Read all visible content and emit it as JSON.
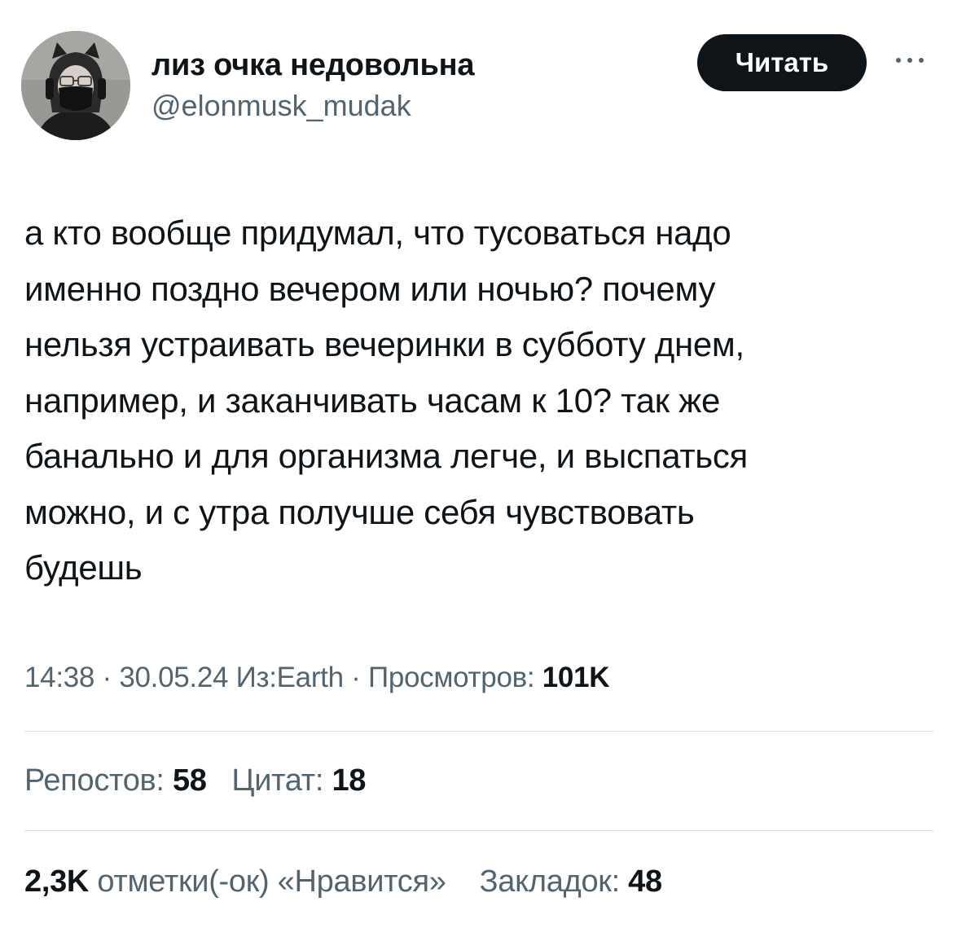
{
  "user": {
    "display_name": "лиз очка недовольна",
    "handle": "@elonmusk_mudak",
    "avatar_icon": "avatar-photo"
  },
  "actions": {
    "follow_label": "Читать",
    "more_icon": "more-icon"
  },
  "tweet": {
    "lines": [
      "а кто вообще придумал, что тусоваться надо",
      "именно поздно вечером или ночью? почему",
      "нельзя устраивать вечеринки в субботу днем,",
      "например, и заканчивать часам к 10? так же",
      "банально и для организма легче, и выспаться",
      "можно, и с утра получше себя чувствовать",
      "будешь"
    ]
  },
  "meta": {
    "time": "14:38",
    "sep1": " · ",
    "date": "30.05.24",
    "source": "Из:Earth",
    "sep2": " · ",
    "views_label": "Просмотров: ",
    "views_value": "101K"
  },
  "stats": {
    "reposts_label": "Репостов: ",
    "reposts_value": "58",
    "quotes_label": "Цитат: ",
    "quotes_value": "18",
    "likes_value": "2,3K",
    "likes_label": " отметки(-ок) «Нравится»",
    "bookmarks_label": "Закладок: ",
    "bookmarks_value": "48"
  },
  "colors": {
    "text": "#0f1419",
    "secondary": "#536471",
    "divider": "#dfe3e6",
    "button_bg": "#0f1419",
    "background": "#ffffff"
  }
}
